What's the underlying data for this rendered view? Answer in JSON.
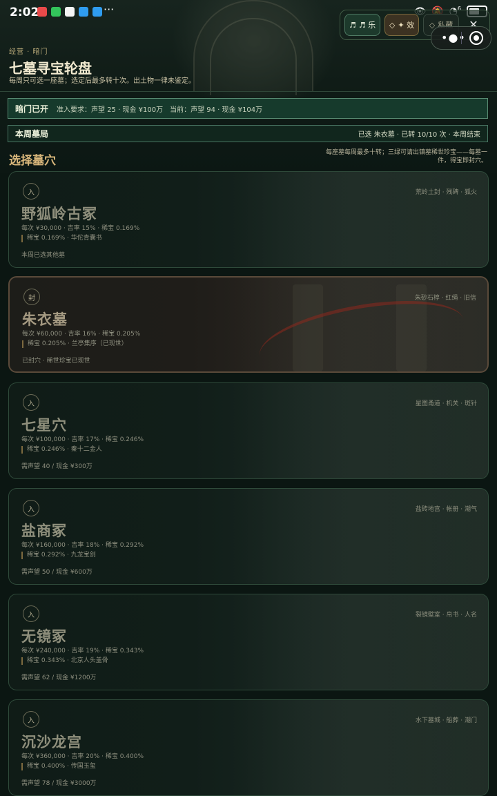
{
  "status_bar": {
    "time": "2:02",
    "more": "···",
    "network_badge": "6",
    "app_icon_colors": [
      "#e94a4a",
      "#33c45b",
      "#f5f5f5",
      "#2f9cf0",
      "#2f9cf0"
    ]
  },
  "toolbar": {
    "music_icon": "♬",
    "music_label": "♬ 乐",
    "effect_icon": "◇",
    "effect_label": "✦ 效",
    "private_icon": "◇",
    "private_label": "私藏",
    "close_icon": "✕"
  },
  "header": {
    "breadcrumb": "经营 · 暗门",
    "title": "七墓寻宝轮盘",
    "subtitle": "每周只可选一座墓；选定后最多转十次。出土物一律未鉴定。"
  },
  "banner_open": {
    "label": "暗门已开",
    "requirement": "准入要求：声望 25 · 现金 ¥100万",
    "current": "当前：声望 94 · 现金 ¥104万"
  },
  "banner_week": {
    "label": "本周墓局",
    "status": "已选 朱衣墓 · 已转 10/10 次 · 本周结束"
  },
  "section": {
    "title": "选择墓穴",
    "note": "每座墓每周最多十转；三绿可请出镇墓稀世珍宝——每墓一件，得宝即封穴。"
  },
  "tombs": [
    {
      "badge": "入",
      "name": "野狐岭古冢",
      "stats": "每次 ¥30,000 · 吉率 15% · 稀宝 0.169%",
      "treasure": "稀宝 0.169% · 华佗青囊书",
      "status": "本周已选其他墓",
      "tags": "荒岭土封 · 残碑 · 狐火"
    },
    {
      "badge": "封",
      "name": "朱衣墓",
      "stats": "每次 ¥60,000 · 吉率 16% · 稀宝 0.205%",
      "treasure": "稀宝 0.205% · 兰亭集序（已现世）",
      "status": "已封穴 · 稀世珍宝已现世",
      "tags": "朱砂石椁 · 红绳 · 旧信"
    },
    {
      "badge": "入",
      "name": "七星穴",
      "stats": "每次 ¥100,000 · 吉率 17% · 稀宝 0.246%",
      "treasure": "稀宝 0.246% · 秦十二金人",
      "status": "需声望 40 / 现金 ¥300万",
      "tags": "星图甬道 · 机关 · 斑针"
    },
    {
      "badge": "入",
      "name": "盐商冢",
      "stats": "每次 ¥160,000 · 吉率 18% · 稀宝 0.292%",
      "treasure": "稀宝 0.292% · 九龙宝剑",
      "status": "需声望 50 / 现金 ¥600万",
      "tags": "盐砖地宫 · 帐册 · 潮气"
    },
    {
      "badge": "入",
      "name": "无镜冢",
      "stats": "每次 ¥240,000 · 吉率 19% · 稀宝 0.343%",
      "treasure": "稀宝 0.343% · 北京人头盖骨",
      "status": "需声望 62 / 现金 ¥1200万",
      "tags": "裂镜壁室 · 帛书 · 人名"
    },
    {
      "badge": "入",
      "name": "沉沙龙宫",
      "stats": "每次 ¥360,000 · 吉率 20% · 稀宝 0.400%",
      "treasure": "稀宝 0.400% · 传国玉玺",
      "status": "需声望 78 / 现金 ¥3000万",
      "tags": "水下墓城 · 船葬 · 潮门"
    }
  ]
}
